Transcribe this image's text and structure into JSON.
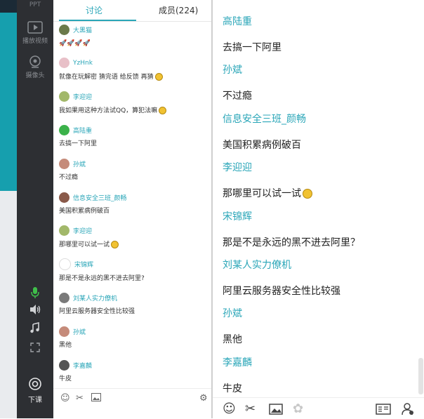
{
  "toolbar": {
    "ppt_label": "PPT",
    "play_label": "播放视频",
    "camera_label": "摄像头",
    "exit_label": "下课"
  },
  "tabs": {
    "discuss": "讨论",
    "members": "成员(224)"
  },
  "left_messages": [
    {
      "name": "大黑猫",
      "text": "🚀🚀🚀🚀",
      "avatar_color": "#6b7a4a",
      "emoji": false
    },
    {
      "name": "YzHnk",
      "text": "就像在玩解密 猜完语 给反馈 再猜",
      "avatar_color": "#e8c0c8",
      "emoji": true
    },
    {
      "name": "李迎迎",
      "text": "我如果用这种方法试QQ，算犯法嘛",
      "avatar_color": "#a2b86a",
      "emoji": true
    },
    {
      "name": "高陆重",
      "text": "去搞一下阿里",
      "avatar_color": "#3bb24a",
      "emoji": false
    },
    {
      "name": "孙斌",
      "text": "不过瘾",
      "avatar_color": "#c58b7a",
      "emoji": false
    },
    {
      "name": "信息安全三班_颜畅",
      "text": "美国积累病例破百",
      "avatar_color": "#8a5a4a",
      "emoji": false
    },
    {
      "name": "李迎迎",
      "text": "那哪里可以试一试",
      "avatar_color": "#a2b86a",
      "emoji": true
    },
    {
      "name": "宋锦辉",
      "text": "那是不是永远的黑不进去阿里?",
      "avatar_color": "#ffffff",
      "emoji": false
    },
    {
      "name": "刘某人实力僚机",
      "text": "阿里云服务器安全性比较强",
      "avatar_color": "#7a7a7a",
      "emoji": false
    },
    {
      "name": "孙斌",
      "text": "黑他",
      "avatar_color": "#c58b7a",
      "emoji": false
    },
    {
      "name": "李嘉麟",
      "text": "牛皮",
      "avatar_color": "#555555",
      "emoji": false
    }
  ],
  "right_messages": [
    {
      "name": "高陆重",
      "text": "去搞一下阿里",
      "emoji": false
    },
    {
      "name": "孙斌",
      "text": "不过瘾",
      "emoji": false
    },
    {
      "name": "信息安全三班_颜畅",
      "text": "美国积累病例破百",
      "emoji": false
    },
    {
      "name": "李迎迎",
      "text": "那哪里可以试一试",
      "emoji": true
    },
    {
      "name": "宋锦辉",
      "text": "那是不是永远的黑不进去阿里？",
      "emoji": false
    },
    {
      "name": "刘某人实力僚机",
      "text": "阿里云服务器安全性比较强",
      "emoji": false
    },
    {
      "name": "孙斌",
      "text": "黑他",
      "emoji": false
    },
    {
      "name": "李嘉麟",
      "text": "牛皮",
      "emoji": false
    }
  ],
  "left_bottom_icons": [
    "emoji-icon",
    "scissors-icon",
    "image-icon",
    "settings-icon"
  ],
  "right_bottom_icons": [
    "emoji-icon",
    "scissors-icon",
    "image-icon",
    "flower-icon",
    "card-icon",
    "user-icon"
  ],
  "colors": {
    "accent": "#2aa6b8",
    "toolbar_bg": "#2d2f33",
    "teal_strip": "#169fae",
    "mic_green": "#3fbf4a"
  }
}
